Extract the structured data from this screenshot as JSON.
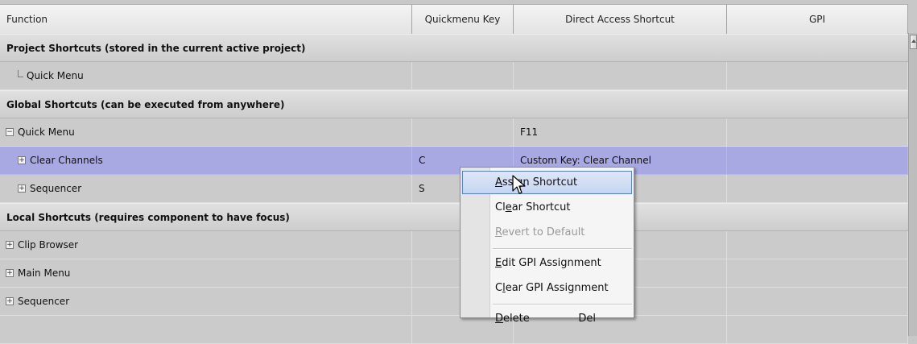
{
  "columns": {
    "function": "Function",
    "quickmenu": "Quickmenu Key",
    "direct": "Direct Access Shortcut",
    "gpi": "GPI"
  },
  "rows": [
    {
      "kind": "group",
      "label": "Project Shortcuts (stored in the current active project)"
    },
    {
      "kind": "item",
      "tree": "leaf",
      "indent": 1,
      "label": "Quick Menu",
      "key": "",
      "shortcut": "",
      "gpi": ""
    },
    {
      "kind": "group",
      "label": "Global Shortcuts (can be executed from anywhere)"
    },
    {
      "kind": "item",
      "tree": "minus",
      "indent": 0,
      "label": "Quick Menu",
      "key": "",
      "shortcut": "F11",
      "gpi": ""
    },
    {
      "kind": "item",
      "tree": "plus",
      "indent": 1,
      "label": "Clear Channels",
      "key": "C",
      "shortcut": "Custom Key: Clear Channel",
      "gpi": "",
      "selected": true
    },
    {
      "kind": "item",
      "tree": "plus",
      "indent": 1,
      "label": "Sequencer",
      "key": "S",
      "shortcut": "",
      "gpi": ""
    },
    {
      "kind": "group",
      "label": "Local Shortcuts (requires component to have focus)"
    },
    {
      "kind": "item",
      "tree": "plus",
      "indent": 0,
      "label": "Clip Browser",
      "key": "",
      "shortcut": "",
      "gpi": ""
    },
    {
      "kind": "item",
      "tree": "plus",
      "indent": 0,
      "label": "Main Menu",
      "key": "",
      "shortcut": "",
      "gpi": ""
    },
    {
      "kind": "item",
      "tree": "plus",
      "indent": 0,
      "label": "Sequencer",
      "key": "",
      "shortcut": "",
      "gpi": ""
    },
    {
      "kind": "item",
      "tree": "none",
      "indent": 0,
      "label": "",
      "key": "",
      "shortcut": "",
      "gpi": ""
    }
  ],
  "context_menu": {
    "items": [
      {
        "label": "Assign Shortcut",
        "underline": "A",
        "highlighted": true,
        "disabled": false,
        "shortcut": ""
      },
      {
        "label": "Clear Shortcut",
        "underline": "e",
        "highlighted": false,
        "disabled": false,
        "shortcut": ""
      },
      {
        "label": "Revert to Default",
        "underline": "R",
        "highlighted": false,
        "disabled": true,
        "shortcut": ""
      },
      {
        "separator": true
      },
      {
        "label": "Edit GPI Assignment",
        "underline": "E",
        "highlighted": false,
        "disabled": false,
        "shortcut": ""
      },
      {
        "label": "Clear GPI Assignment",
        "underline": "l",
        "highlighted": false,
        "disabled": false,
        "shortcut": ""
      },
      {
        "separator": true
      },
      {
        "label": "Delete",
        "underline": "D",
        "highlighted": false,
        "disabled": false,
        "shortcut": "Del"
      }
    ]
  },
  "colors": {
    "selected_row": "#a8a8e2",
    "menu_highlight_border": "#5a7fc9"
  }
}
